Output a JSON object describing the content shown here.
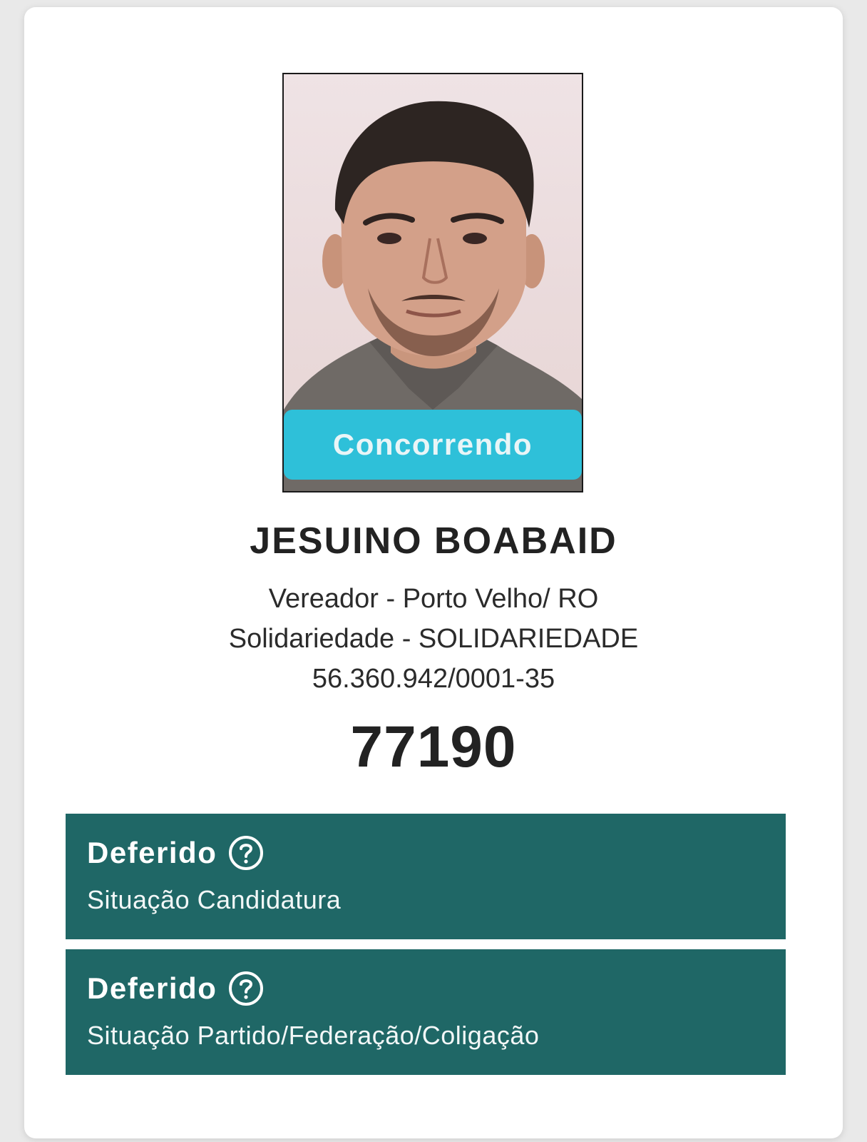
{
  "candidate": {
    "photo_alt": "Foto do candidato",
    "status_ribbon": "Concorrendo",
    "name": "JESUINO BOABAID",
    "office_line": "Vereador - Porto Velho/ RO",
    "party_line": "Solidariedade - SOLIDARIEDADE",
    "cnpj": "56.360.942/0001-35",
    "number": "77190"
  },
  "status_boxes": [
    {
      "value": "Deferido",
      "label": "Situação Candidatura",
      "icon": "help-circle-icon"
    },
    {
      "value": "Deferido",
      "label": "Situação Partido/Federação/Coligação",
      "icon": "help-circle-icon"
    }
  ],
  "colors": {
    "ribbon": "#2ec0d9",
    "status_box": "#1f6766",
    "text": "#222222",
    "page_bg": "#e9e9e9"
  }
}
